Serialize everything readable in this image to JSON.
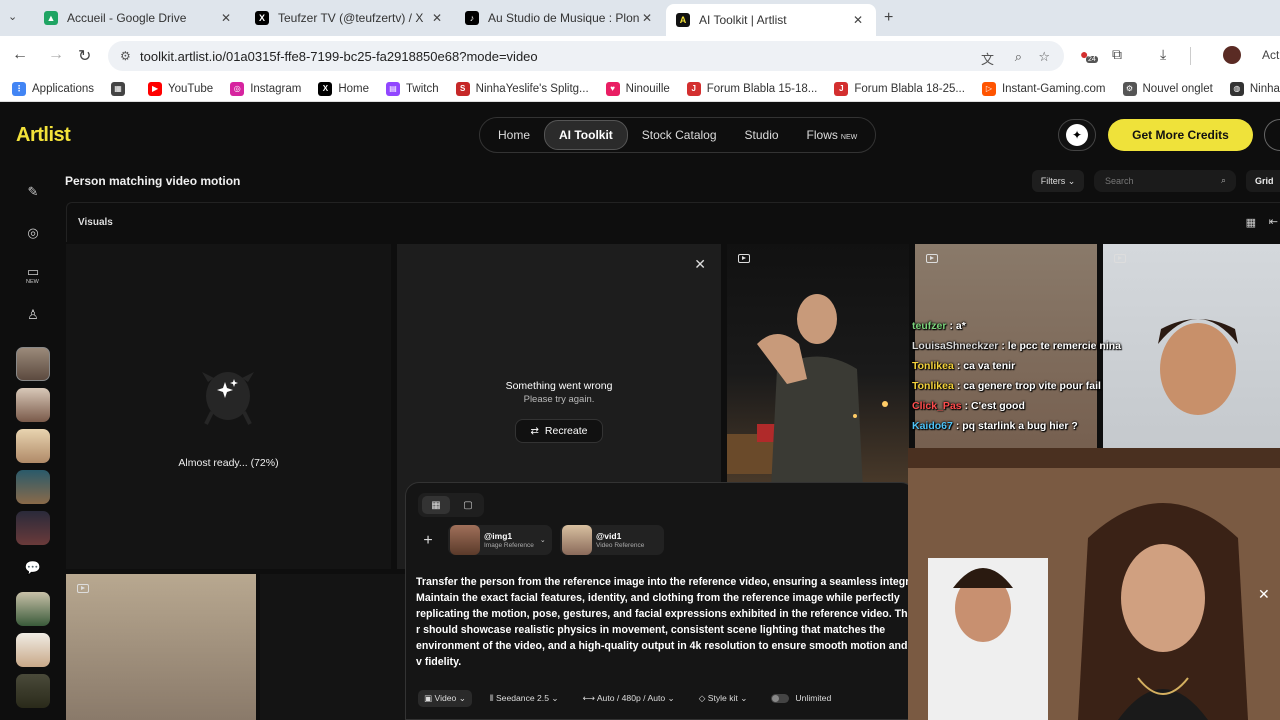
{
  "browser": {
    "tabs": [
      {
        "title": "Accueil - Google Drive",
        "favicon": "google-drive-icon",
        "color": "#1fa463"
      },
      {
        "title": "Teufzer TV (@teufzertv) / X",
        "favicon": "x-icon",
        "color": "#000000"
      },
      {
        "title": "Au Studio de Musique : Plonge...",
        "favicon": "tiktok-icon",
        "color": "#000000"
      },
      {
        "title": "AI Toolkit | Artlist",
        "favicon": "artlist-icon",
        "color": "#111111"
      }
    ],
    "url": "toolkit.artlist.io/01a0315f-ffe8-7199-bc25-fa2918850e68?mode=video",
    "extension_badge": "24",
    "right_label": "Acti",
    "bookmarks": [
      {
        "label": "Applications",
        "icon": "apps-grid-icon",
        "color": "#4285f4"
      },
      {
        "label": "",
        "icon": "dashboard-icon",
        "color": "#444444"
      },
      {
        "label": "YouTube",
        "icon": "youtube-icon",
        "color": "#ff0000"
      },
      {
        "label": "Instagram",
        "icon": "instagram-icon",
        "color": "#d6249f"
      },
      {
        "label": "Home",
        "icon": "x-icon",
        "color": "#000000"
      },
      {
        "label": "Twitch",
        "icon": "twitch-icon",
        "color": "#9146ff"
      },
      {
        "label": "NinhaYeslife's Splitg...",
        "icon": "splits-icon",
        "color": "#c62828"
      },
      {
        "label": "Ninouille",
        "icon": "heart-icon",
        "color": "#e91e63"
      },
      {
        "label": "Forum Blabla 15-18...",
        "icon": "jvc-icon",
        "color": "#d32f2f"
      },
      {
        "label": "Forum Blabla 18-25...",
        "icon": "jvc-icon",
        "color": "#d32f2f"
      },
      {
        "label": "Instant-Gaming.com",
        "icon": "instant-gaming-icon",
        "color": "#ff5400"
      },
      {
        "label": "Nouvel onglet",
        "icon": "gear-icon",
        "color": "#555555"
      },
      {
        "label": "Ninha Predictions",
        "icon": "globe-icon",
        "color": "#333333"
      }
    ]
  },
  "app": {
    "logo": "Artlist",
    "nav": [
      {
        "label": "Home",
        "active": false,
        "badge": ""
      },
      {
        "label": "AI Toolkit",
        "active": true,
        "badge": ""
      },
      {
        "label": "Stock Catalog",
        "active": false,
        "badge": ""
      },
      {
        "label": "Studio",
        "active": false,
        "badge": ""
      },
      {
        "label": "Flows",
        "active": false,
        "badge": "NEW"
      }
    ],
    "credits_button": "Get More Credits",
    "accent": "#efe23a",
    "sidebar_new_badge": "NEW",
    "page_title": "Person matching video motion",
    "filters_label": "Filters",
    "search_placeholder": "Search",
    "grid_label": "Grid",
    "visuals_label": "Visuals",
    "generating": {
      "status": "Almost ready... (72%)",
      "progress": 0.72
    },
    "error_card": {
      "title": "Something went wrong",
      "subtitle": "Please try again.",
      "action": "Recreate"
    }
  },
  "composer": {
    "refs": [
      {
        "name": "@img1",
        "type": "Image Reference"
      },
      {
        "name": "@vid1",
        "type": "Video Reference"
      }
    ],
    "prompt": "Transfer the person from the reference image into the reference video, ensuring a seamless integra Maintain the exact facial features, identity, and clothing from the reference image while perfectly replicating the motion, pose, gestures, and facial expressions exhibited in the reference video. The r should showcase realistic physics in movement, consistent scene lighting that matches the environment of the video, and a high-quality output in 4k resolution to ensure smooth motion and v fidelity.",
    "options": {
      "mode": "Video",
      "model": "Seedance 2.5",
      "format": "Auto / 480p / Auto",
      "style": "Style kit",
      "unlimited": "Unlimited"
    }
  },
  "stream_chat": [
    {
      "user": "teufzer",
      "message": ": a*",
      "color": "#7bd37b"
    },
    {
      "user": "LouisaShneckzer",
      "message": ": le pcc te remercie nina",
      "color": "#d9d9d9"
    },
    {
      "user": "Tonlikea",
      "message": ": ca va tenir",
      "color": "#f4d23b"
    },
    {
      "user": "Tonlikea",
      "message": ": ca genere trop vite pour fail",
      "color": "#f4d23b"
    },
    {
      "user": "Click_Pas",
      "message": ": C'est good",
      "color": "#ff4d4d"
    },
    {
      "user": "Kaido67",
      "message": ": pq starlink a bug hier ?",
      "color": "#4fc3f7"
    }
  ]
}
